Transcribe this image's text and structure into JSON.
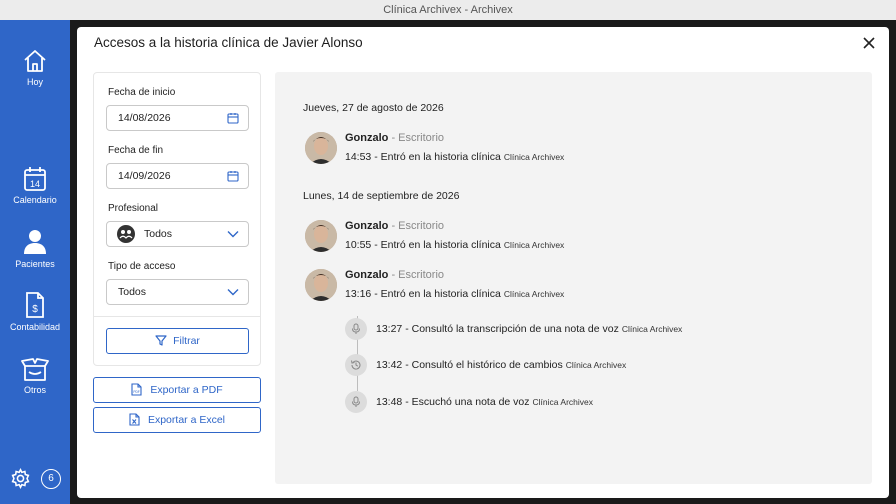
{
  "window": {
    "title": "Clínica Archivex - Archivex"
  },
  "sidebar": {
    "items": [
      {
        "label": "Hoy",
        "icon": "home-icon"
      },
      {
        "label": "Calendario",
        "icon": "calendar-icon",
        "day": "14"
      },
      {
        "label": "Pacientes",
        "icon": "person-icon"
      },
      {
        "label": "Contabilidad",
        "icon": "invoice-icon"
      },
      {
        "label": "Otros",
        "icon": "box-icon"
      }
    ],
    "notifications": "6",
    "accent": "#2f66c8"
  },
  "dialog": {
    "title": "Accesos a la historia clínica de Javier Alonso",
    "filters": {
      "start_label": "Fecha de inicio",
      "start_value": "14/08/2026",
      "end_label": "Fecha de fin",
      "end_value": "14/09/2026",
      "professional_label": "Profesional",
      "professional_value": "Todos",
      "access_label": "Tipo de acceso",
      "access_value": "Todos",
      "filter_button": "Filtrar"
    },
    "export_pdf": "Exportar a PDF",
    "export_excel": "Exportar a Excel"
  },
  "log": {
    "days": [
      {
        "date": "Jueves, 27 de agosto de 2026",
        "entries": [
          {
            "user": "Gonzalo",
            "device": " - Escritorio",
            "action": "14:53 - Entró en la historia clínica",
            "clinic": "Clínica Archivex"
          }
        ]
      },
      {
        "date": "Lunes, 14 de septiembre de 2026",
        "entries": [
          {
            "user": "Gonzalo",
            "device": " - Escritorio",
            "action": "10:55 - Entró en la historia clínica",
            "clinic": "Clínica Archivex"
          },
          {
            "user": "Gonzalo",
            "device": " - Escritorio",
            "action": "13:16 - Entró en la historia clínica",
            "clinic": "Clínica Archivex"
          }
        ]
      }
    ],
    "sub_entries": [
      {
        "icon": "microphone-icon",
        "text": "13:27 - Consultó la transcripción de una nota de voz",
        "clinic": "Clínica Archivex"
      },
      {
        "icon": "history-icon",
        "text": "13:42 - Consultó el histórico de cambios",
        "clinic": "Clínica Archivex"
      },
      {
        "icon": "microphone-icon",
        "text": "13:48 - Escuchó una nota de voz",
        "clinic": "Clínica Archivex"
      }
    ]
  }
}
